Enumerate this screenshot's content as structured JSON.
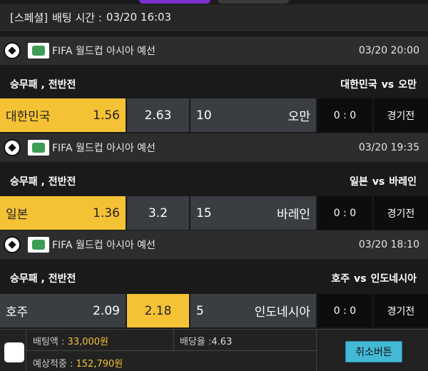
{
  "header": {
    "category": "[스페셜]",
    "bet_time_label": "배팅 시간 :",
    "bet_time": "03/20 16:03"
  },
  "matches": [
    {
      "league": "FIFA 월드컵 아시아 예선",
      "datetime": "03/20 20:00",
      "bet_type": "승무패 , 전반전",
      "home": "대한민국",
      "away": "오만",
      "vs": "vs",
      "home_odds": "1.56",
      "draw_odds": "2.63",
      "away_odds": "10",
      "selected": "home",
      "score": "0 : 0",
      "status": "경기전"
    },
    {
      "league": "FIFA 월드컵 아시아 예선",
      "datetime": "03/20 19:35",
      "bet_type": "승무패 , 전반전",
      "home": "일본",
      "away": "바레인",
      "vs": "vs",
      "home_odds": "1.36",
      "draw_odds": "3.2",
      "away_odds": "15",
      "selected": "home",
      "score": "0 : 0",
      "status": "경기전"
    },
    {
      "league": "FIFA 월드컵 아시아 예선",
      "datetime": "03/20 18:10",
      "bet_type": "승무패 , 전반전",
      "home": "호주",
      "away": "인도네시아",
      "vs": "vs",
      "home_odds": "2.09",
      "draw_odds": "2.18",
      "away_odds": "5",
      "selected": "draw",
      "score": "0 : 0",
      "status": "경기전"
    }
  ],
  "footer": {
    "bet_amount_label": "배팅액 :",
    "bet_amount": "33,000원",
    "odds_label": "배당율 :",
    "odds": "4.63",
    "expected_label": "예상적중 :",
    "expected": "152,790원",
    "cancel_label": "취소버튼"
  },
  "colors": {
    "selected": "#f5c235",
    "cell": "#3a3d42",
    "cancel_button": "#44b9d6",
    "active_tab": "#7d2fd0"
  }
}
